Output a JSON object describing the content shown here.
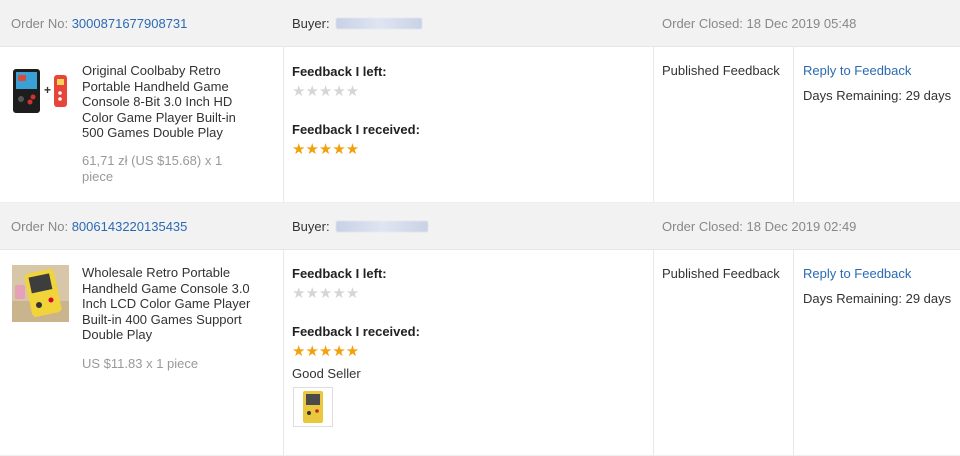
{
  "orders": [
    {
      "order_label": "Order No:",
      "order_no": "3000871677908731",
      "buyer_label": "Buyer:",
      "closed_label": "Order Closed:",
      "closed_date": "18 Dec 2019 05:48",
      "product_title": "Original Coolbaby Retro Portable Handheld Game Console 8-Bit 3.0 Inch HD Color Game Player Built-in 500 Games Double Play",
      "price": "61,71 zł (US $15.68) x 1 piece",
      "feedback_left_label": "Feedback I left:",
      "feedback_left_stars": 0,
      "feedback_received_label": "Feedback I received:",
      "feedback_received_stars": 5,
      "status": "Published Feedback",
      "reply_link": "Reply to Feedback",
      "days_remaining": "Days Remaining: 29 days",
      "product_icon": "handheld-console-thumbnail"
    },
    {
      "order_label": "Order No:",
      "order_no": "8006143220135435",
      "buyer_label": "Buyer:",
      "closed_label": "Order Closed:",
      "closed_date": "18 Dec 2019 02:49",
      "product_title": "Wholesale Retro Portable Handheld Game Console 3.0 Inch LCD Color Game Player Built-in 400 Games Support Double Play",
      "price": "US $11.83 x 1 piece",
      "feedback_left_label": "Feedback I left:",
      "feedback_left_stars": 0,
      "feedback_received_label": "Feedback I received:",
      "feedback_received_stars": 5,
      "feedback_comment": "Good Seller",
      "status": "Published Feedback",
      "reply_link": "Reply to Feedback",
      "days_remaining": "Days Remaining: 29 days",
      "product_icon": "yellow-console-thumbnail"
    }
  ],
  "colors": {
    "link": "#2b6ab3",
    "star": "#f3a00f",
    "header_bg": "#f2f2f2"
  }
}
